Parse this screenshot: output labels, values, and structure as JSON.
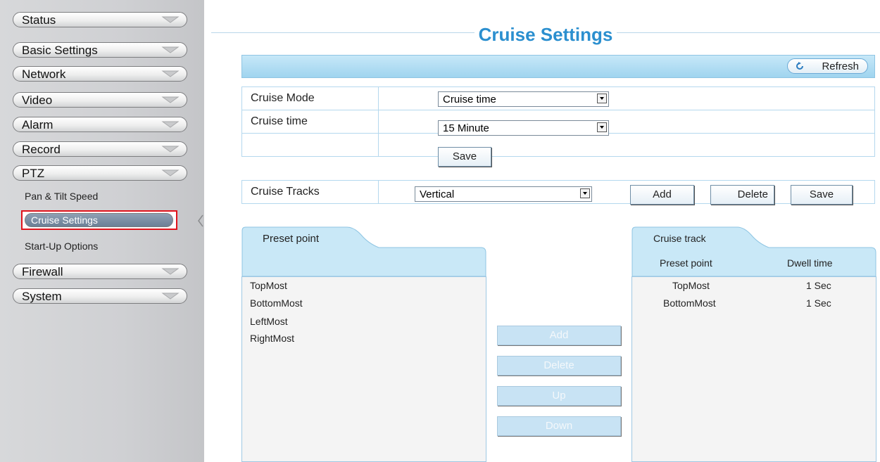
{
  "sidebar": {
    "menu": [
      {
        "label": "Status"
      },
      {
        "label": "Basic Settings"
      },
      {
        "label": "Network"
      },
      {
        "label": "Video"
      },
      {
        "label": "Alarm"
      },
      {
        "label": "Record"
      },
      {
        "label": "PTZ"
      }
    ],
    "ptz_sub": {
      "pan_tilt": "Pan & Tilt Speed",
      "cruise": "Cruise Settings",
      "startup": "Start-Up Options"
    },
    "menu_after": [
      {
        "label": "Firewall"
      },
      {
        "label": "System"
      }
    ]
  },
  "page": {
    "title": "Cruise Settings",
    "refresh_label": "Refresh"
  },
  "form": {
    "cruise_mode_label": "Cruise Mode",
    "cruise_mode_value": "Cruise time",
    "cruise_time_label": "Cruise time",
    "cruise_time_value": "15 Minute",
    "save_label": "Save",
    "tracks_label": "Cruise Tracks",
    "tracks_value": "Vertical",
    "add_label": "Add",
    "delete_label": "Delete",
    "save2_label": "Save"
  },
  "preset_panel": {
    "tab": "Preset point",
    "items": [
      "TopMost",
      "BottomMost",
      "LeftMost",
      "RightMost"
    ]
  },
  "middle_buttons": {
    "add": "Add",
    "delete": "Delete",
    "up": "Up",
    "down": "Down"
  },
  "track_panel": {
    "tab": "Cruise track",
    "col_preset": "Preset point",
    "col_dwell": "Dwell time",
    "rows": [
      {
        "point": "TopMost",
        "dwell": "1 Sec"
      },
      {
        "point": "BottomMost",
        "dwell": "1 Sec"
      }
    ]
  },
  "colors": {
    "title": "#2b8fcf",
    "highlight_border": "#e0131b",
    "toolbar": "#a9daf1"
  }
}
